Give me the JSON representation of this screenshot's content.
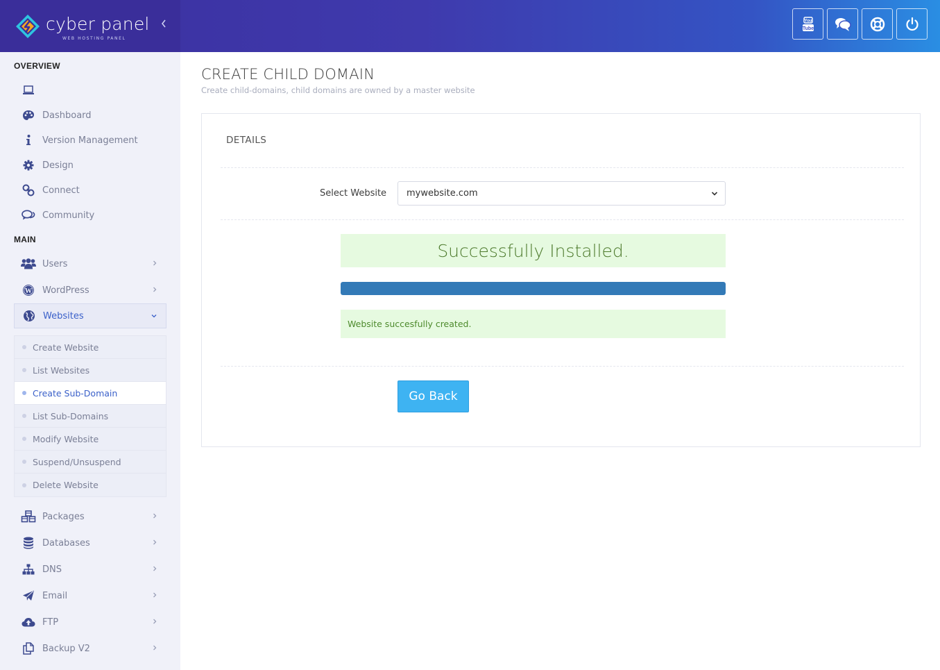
{
  "brand": {
    "name": "cyber panel",
    "tagline": "WEB HOSTING PANEL",
    "colors": {
      "header_left": "#3a2e9a",
      "header_right": "#2a8ee3",
      "accent": "#3a60c9",
      "success_bg": "#e6fae0",
      "button": "#3eb3f2",
      "progress": "#337ab7"
    }
  },
  "header": {
    "collapse_icon": "chevron-left-icon",
    "buttons": [
      {
        "icon": "youtube-icon"
      },
      {
        "icon": "chat-bubbles-icon"
      },
      {
        "icon": "life-ring-icon"
      },
      {
        "icon": "power-icon"
      }
    ]
  },
  "sidebar": {
    "overview_heading": "OVERVIEW",
    "main_heading": "MAIN",
    "overview_items": [
      {
        "label": "",
        "icon": "laptop-icon"
      },
      {
        "label": "Dashboard",
        "icon": "palette-icon"
      },
      {
        "label": "Version Management",
        "icon": "info-icon"
      },
      {
        "label": "Design",
        "icon": "gear-icon"
      },
      {
        "label": "Connect",
        "icon": "link-icon"
      },
      {
        "label": "Community",
        "icon": "comments-icon"
      }
    ],
    "main_items": [
      {
        "label": "Users",
        "icon": "users-icon"
      },
      {
        "label": "WordPress",
        "icon": "wordpress-icon"
      },
      {
        "label": "Websites",
        "icon": "globe-icon"
      },
      {
        "label": "Packages",
        "icon": "cubes-icon"
      },
      {
        "label": "Databases",
        "icon": "database-icon"
      },
      {
        "label": "DNS",
        "icon": "sitemap-icon"
      },
      {
        "label": "Email",
        "icon": "paper-plane-icon"
      },
      {
        "label": "FTP",
        "icon": "cloud-upload-icon"
      },
      {
        "label": "Backup V2",
        "icon": "copy-icon"
      }
    ],
    "websites_submenu": [
      {
        "label": "Create Website"
      },
      {
        "label": "List Websites"
      },
      {
        "label": "Create Sub-Domain"
      },
      {
        "label": "List Sub-Domains"
      },
      {
        "label": "Modify Website"
      },
      {
        "label": "Suspend/Unsuspend"
      },
      {
        "label": "Delete Website"
      }
    ]
  },
  "main": {
    "title": "CREATE CHILD DOMAIN",
    "subtitle": "Create child-domains, child domains are owned by a master website",
    "panel_title": "DETAILS",
    "select_label": "Select Website",
    "select_value": "mywebsite.com",
    "success_text": "Successfully Installed.",
    "progress_percent": 100,
    "message": "Website succesfully created.",
    "go_back_label": "Go Back"
  }
}
